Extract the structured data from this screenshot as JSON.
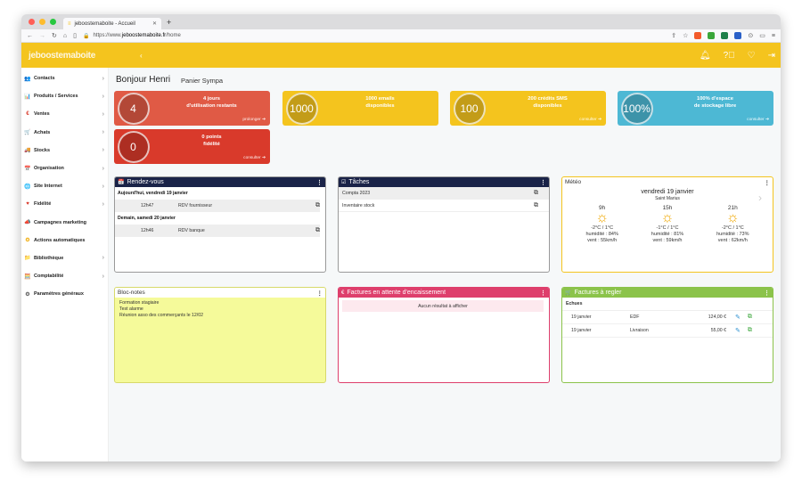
{
  "browser": {
    "tab_title": "jeboostemaboite - Accueil",
    "url_prefix": "https://www.",
    "url_domain": "jeboostemaboite.fr",
    "url_path": "/home"
  },
  "app": {
    "logo_part1": "jeboost",
    "logo_part2": "emaboite",
    "greeting": "Bonjour Henri",
    "panier": "Panier Sympa",
    "arrow": "‹"
  },
  "sidebar": {
    "items": [
      {
        "label": "Contacts",
        "icon": "👥",
        "chev": "›"
      },
      {
        "label": "Produits / Services",
        "icon": "📊",
        "chev": "›"
      },
      {
        "label": "Ventes",
        "icon": "€",
        "chev": "›"
      },
      {
        "label": "Achats",
        "icon": "🛒",
        "chev": "›"
      },
      {
        "label": "Stocks",
        "icon": "🚚",
        "chev": "›"
      },
      {
        "label": "Organisation",
        "icon": "📅",
        "chev": "›"
      },
      {
        "label": "Site Internet",
        "icon": "🌐",
        "chev": "›"
      },
      {
        "label": "Fidélité",
        "icon": "♥",
        "chev": "›"
      },
      {
        "label": "Campagnes marketing",
        "icon": "📣",
        "chev": ""
      },
      {
        "label": "Actions automatiques",
        "icon": "⚙",
        "chev": ""
      },
      {
        "label": "Bibliothèque",
        "icon": "📁",
        "chev": "›"
      },
      {
        "label": "Comptabilité",
        "icon": "🧮",
        "chev": "›"
      },
      {
        "label": "Paramètres généraux",
        "icon": "⚙",
        "chev": ""
      }
    ]
  },
  "cards": [
    {
      "value": "4",
      "line1": "4 jours",
      "line2": "d'utilisation restants",
      "link": "prolonger",
      "color": "#e05a45"
    },
    {
      "value": "1000",
      "line1": "1000 emails",
      "line2": "disponibles",
      "link": "",
      "color": "#f4c41e"
    },
    {
      "value": "100",
      "line1": "200 crédits SMS",
      "line2": "disponibles",
      "link": "consulter",
      "color": "#f4c41e"
    },
    {
      "value": "100%",
      "line1": "100% d'espace",
      "line2": "de stockage libre",
      "link": "consulter",
      "color": "#4db8d4"
    },
    {
      "value": "0",
      "line1": "0 points",
      "line2": "fidélité",
      "link": "consulter",
      "color": "#d93a2b"
    }
  ],
  "rdv": {
    "title": "Rendez-vous",
    "menu": "⋮",
    "day1": "Aujourd'hui, vendredi 19 janvier",
    "day1_time": "12h47",
    "day1_label": "RDV fournisseur",
    "day2": "Demain, samedi 20 janvier",
    "day2_time": "12h46",
    "day2_label": "RDV banque"
  },
  "taches": {
    "title": "Tâches",
    "menu": "⋮",
    "items": [
      "Compta 2023",
      "Inventaire stock"
    ]
  },
  "meteo": {
    "title": "Météo",
    "menu": "⋮",
    "date": "vendredi 19 janvier",
    "place": "Saint Marius",
    "nav": "›",
    "slots": [
      {
        "hour": "9h",
        "temp": "-2°C / 1°C",
        "hum": "humidité : 84%",
        "wind": "vent : 55km/h"
      },
      {
        "hour": "15h",
        "temp": "-1°C / 1°C",
        "hum": "humidité : 81%",
        "wind": "vent : 59km/h"
      },
      {
        "hour": "21h",
        "temp": "-2°C / 1°C",
        "hum": "humidité : 73%",
        "wind": "vent : 62km/h"
      }
    ]
  },
  "bloc": {
    "title": "Bloc-notes",
    "menu": "⋮",
    "lines": [
      "Formation stagiaire",
      "Test alarme",
      "Réunion asso des commerçants le 12/02"
    ]
  },
  "factures_enc": {
    "title": "Factures en attente d'encaissement",
    "menu": "⋮",
    "empty": "Aucun résultat à afficher"
  },
  "factures_reg": {
    "title": "Factures à regler",
    "menu": "⋮",
    "section": "Echues",
    "rows": [
      {
        "date": "19 janvier",
        "name": "EDF",
        "amount": "124,00 €"
      },
      {
        "date": "19 janvier",
        "name": "Livraison",
        "amount": "55,00 €"
      }
    ]
  },
  "colors": {
    "yellow": "#f4c41e",
    "navy": "#1a2348",
    "pink": "#de3f6c",
    "green": "#8bc34a"
  }
}
